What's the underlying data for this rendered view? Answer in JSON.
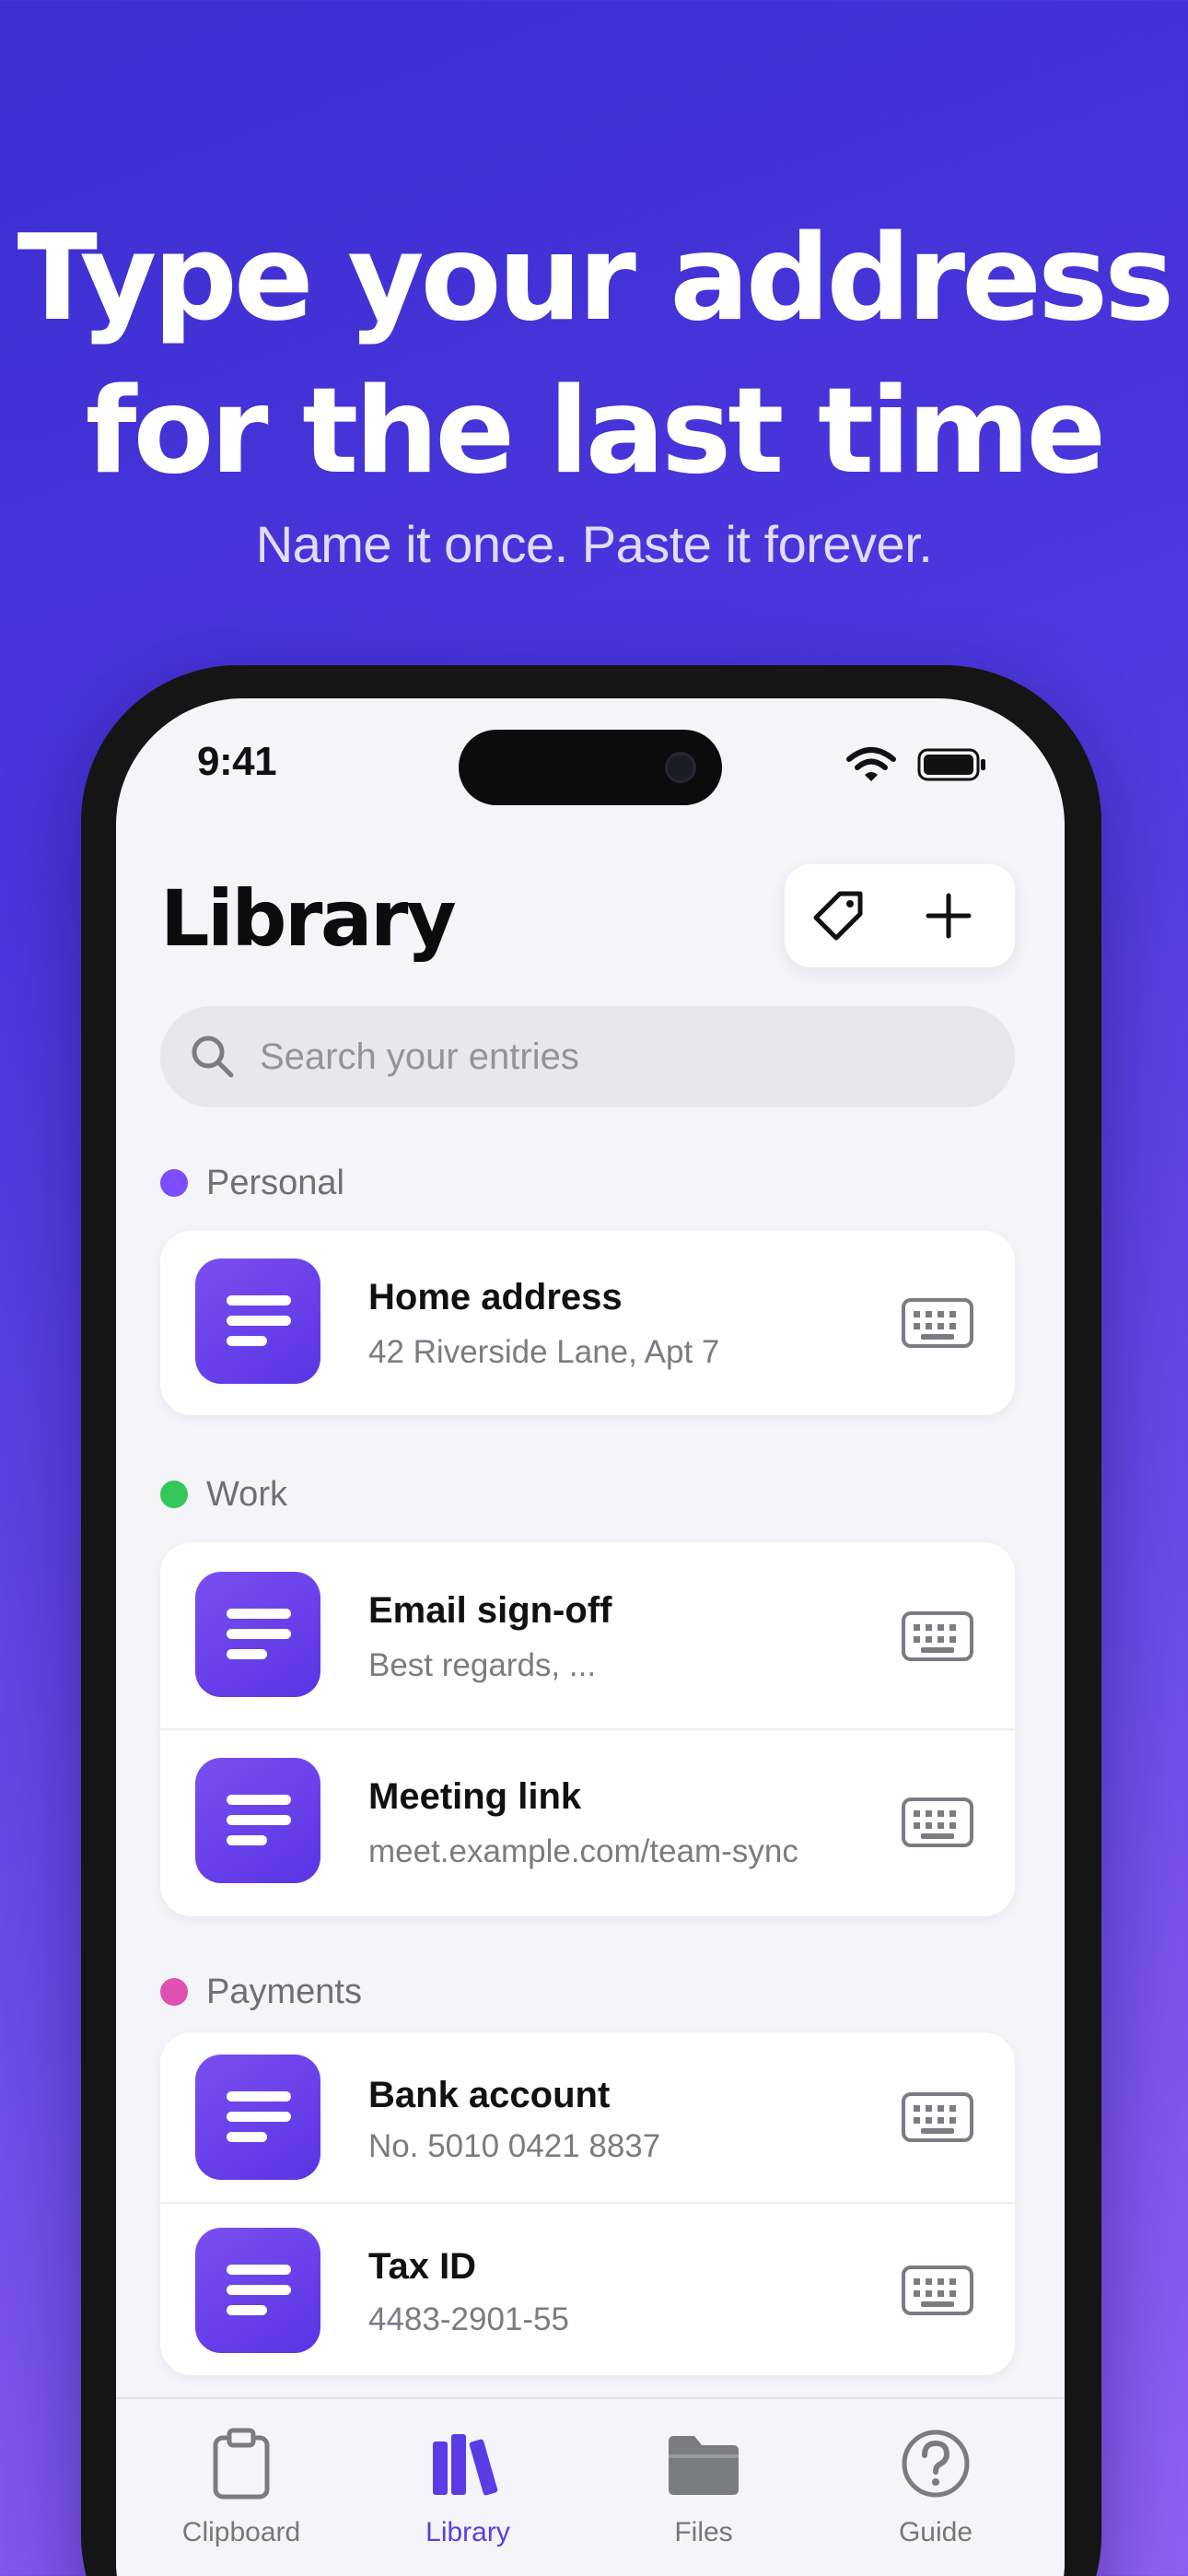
{
  "hero": {
    "headline_line1": "Type your address",
    "headline_line2": "for the last time",
    "subheadline": "Name it once. Paste it forever."
  },
  "status_bar": {
    "time": "9:41"
  },
  "header": {
    "title": "Library"
  },
  "search": {
    "placeholder": "Search your entries"
  },
  "sections": [
    {
      "label": "Personal",
      "color": "#7c4dff",
      "items": [
        {
          "title": "Home address",
          "subtitle": "42 Riverside Lane, Apt 7"
        }
      ]
    },
    {
      "label": "Work",
      "color": "#34c759",
      "items": [
        {
          "title": "Email sign-off",
          "subtitle": "Best regards, ..."
        },
        {
          "title": "Meeting link",
          "subtitle": "meet.example.com/team-sync"
        }
      ]
    },
    {
      "label": "Payments",
      "color": "#e050b0",
      "items": [
        {
          "title": "Bank account",
          "subtitle": "No. 5010 0421 8837"
        },
        {
          "title": "Tax ID",
          "subtitle": "4483-2901-55"
        }
      ]
    }
  ],
  "tabbar": {
    "tabs": [
      {
        "label": "Clipboard",
        "icon": "clipboard-icon"
      },
      {
        "label": "Library",
        "icon": "books-icon",
        "active": true
      },
      {
        "label": "Files",
        "icon": "folder-icon"
      },
      {
        "label": "Guide",
        "icon": "question-circle-icon"
      }
    ]
  },
  "colors": {
    "accent": "#5a3ce6",
    "background_gradient": [
      "#3b2fd0",
      "#8f63f2"
    ],
    "entry_icon": "#6a42ea"
  }
}
